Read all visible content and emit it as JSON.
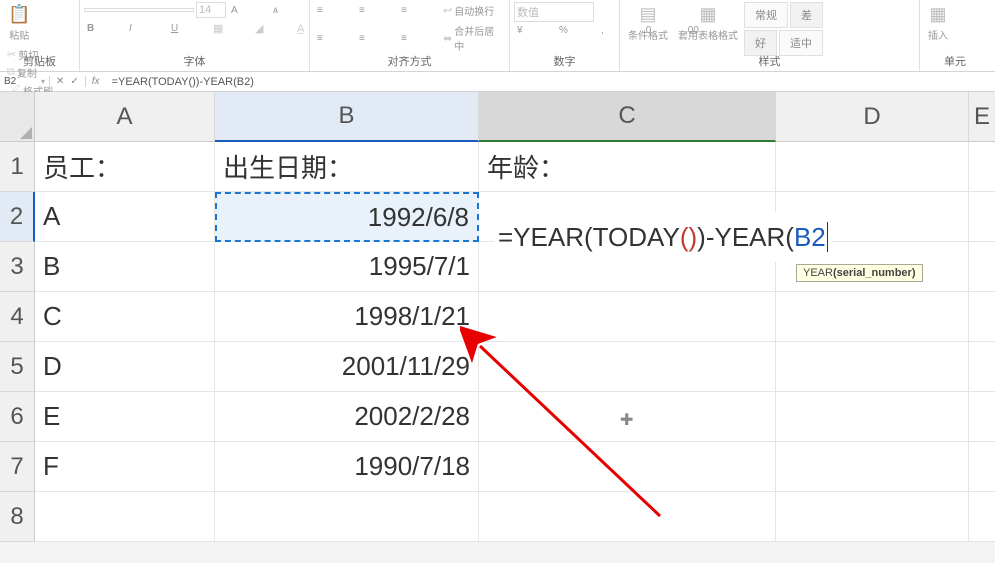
{
  "ribbon": {
    "clipboard": {
      "label": "剪贴板",
      "paste": "粘贴",
      "cut": "剪切",
      "copy": "复制",
      "format_painter": "格式刷"
    },
    "font": {
      "label": "字体",
      "font_name": "",
      "font_size": "14",
      "bold": "B",
      "italic": "I",
      "underline": "U"
    },
    "alignment": {
      "label": "对齐方式",
      "wrap": "自动换行",
      "merge": "合并后居中"
    },
    "number": {
      "label": "数字",
      "format": "数值"
    },
    "styles": {
      "label": "样式",
      "conditional": "条件格式",
      "cell_styles": "套用表格格式",
      "normal": "常规",
      "good": "好",
      "bad": "差",
      "neutral": "适中"
    },
    "cells": {
      "label": "单元",
      "insert": "插入"
    }
  },
  "formula_bar": {
    "name_box": "B2",
    "formula": "=YEAR(TODAY())-YEAR(B2)"
  },
  "columns": [
    "A",
    "B",
    "C",
    "D",
    "E"
  ],
  "rows": [
    "1",
    "2",
    "3",
    "4",
    "5",
    "6",
    "7",
    "8"
  ],
  "active_col": "C",
  "ref_col": "B",
  "active_row": "2",
  "data": {
    "A1": "员工：",
    "B1": "出生日期：",
    "C1": "年龄：",
    "A2": "A",
    "B2": "1992/6/8",
    "A3": "B",
    "B3": "1995/7/1",
    "A4": "C",
    "B4": "1998/1/21",
    "A5": "D",
    "B5": "2001/11/29",
    "A6": "E",
    "B6": "2002/2/28",
    "A7": "F",
    "B7": "1990/7/18"
  },
  "editing_cell": {
    "prefix": "=YEAR(TODAY(",
    "inner_paren": "()",
    "mid": "))-YEAR(",
    "ref": "B2"
  },
  "tooltip": {
    "func": "YEAR",
    "args": "(serial_number)"
  }
}
